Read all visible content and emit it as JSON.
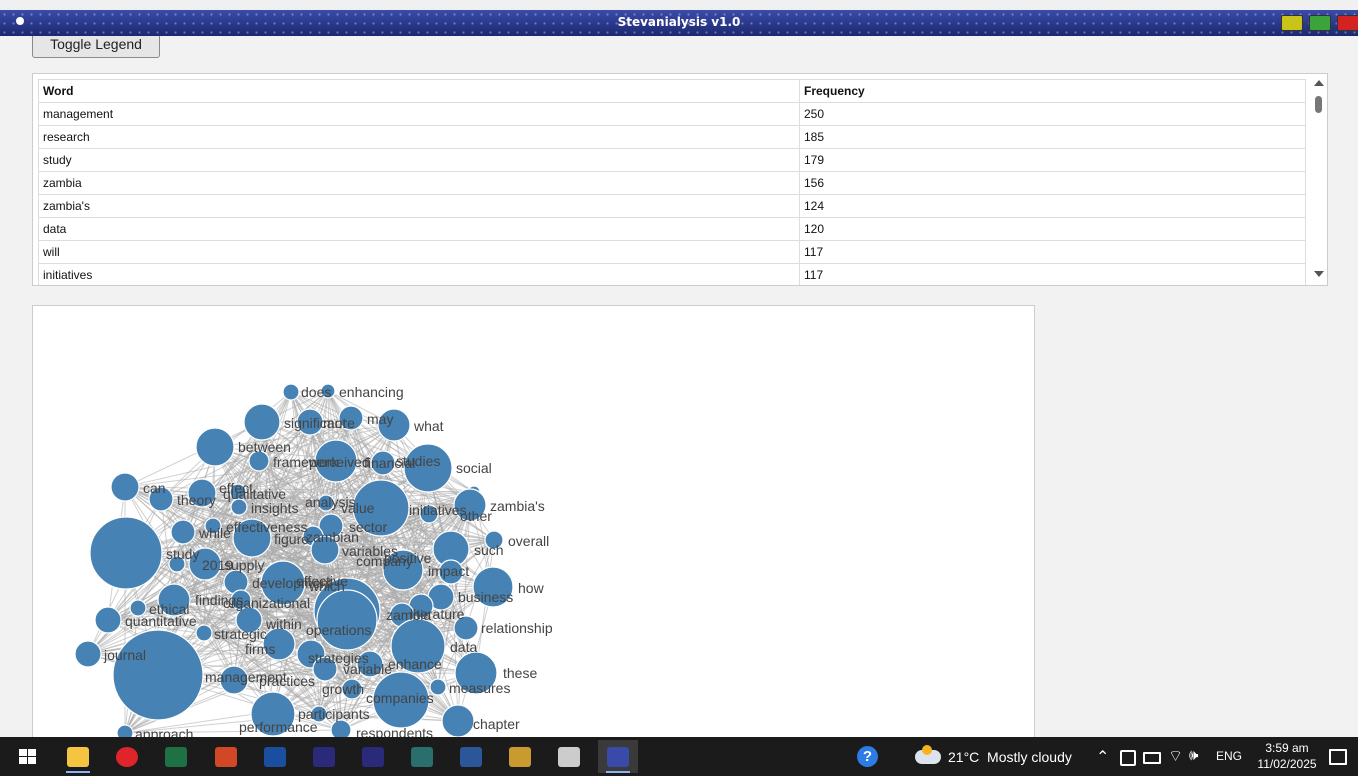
{
  "window": {
    "title": "Stevanialysis v1.0"
  },
  "toolbar": {
    "toggle_legend": "Toggle Legend"
  },
  "table": {
    "headers": [
      "Word",
      "Frequency"
    ],
    "rows": [
      [
        "management",
        "250"
      ],
      [
        "research",
        "185"
      ],
      [
        "study",
        "179"
      ],
      [
        "zambia",
        "156"
      ],
      [
        "zambia's",
        "124"
      ],
      [
        "data",
        "120"
      ],
      [
        "will",
        "117"
      ],
      [
        "initiatives",
        "117"
      ]
    ]
  },
  "graph": {
    "edge_color": "#aaaaaa",
    "node_color": "#4682b4",
    "label_color": "#444444",
    "words": [
      "does",
      "enhancing",
      "significant",
      "more",
      "may",
      "what",
      "between",
      "framework",
      "perceived",
      "financial",
      "studies",
      "social",
      "can",
      "theory",
      "effect",
      "qualitative",
      "analysis",
      "value",
      "insights",
      "initiatives",
      "other",
      "zambia's",
      "effectiveness",
      "sector",
      "while",
      "figure",
      "zambian",
      "variables",
      "positive",
      "company",
      "such",
      "overall",
      "study",
      "2019",
      "supply",
      "development",
      "effective",
      "which",
      "impact",
      "how",
      "business",
      "findings",
      "organizational",
      "zambia",
      "literature",
      "ethical",
      "quantitative",
      "within",
      "operations",
      "strategic",
      "relationship",
      "firms",
      "data",
      "journal",
      "strategies",
      "enhance",
      "these",
      "management",
      "variable",
      "practices",
      "measures",
      "growth",
      "companies",
      "participants",
      "chapter",
      "performance",
      "respondents",
      "approach"
    ]
  },
  "taskbar": {
    "apps": [
      "windows-start",
      "file-explorer",
      "opera",
      "excel",
      "powerpoint",
      "mendeley",
      "premiere",
      "after-effects",
      "app-green",
      "word",
      "game",
      "library",
      "stevanialysis"
    ],
    "weather": "21°C  Mostly cloudy",
    "lang": "ENG",
    "time": "3:59 am",
    "date": "11/02/2025"
  }
}
